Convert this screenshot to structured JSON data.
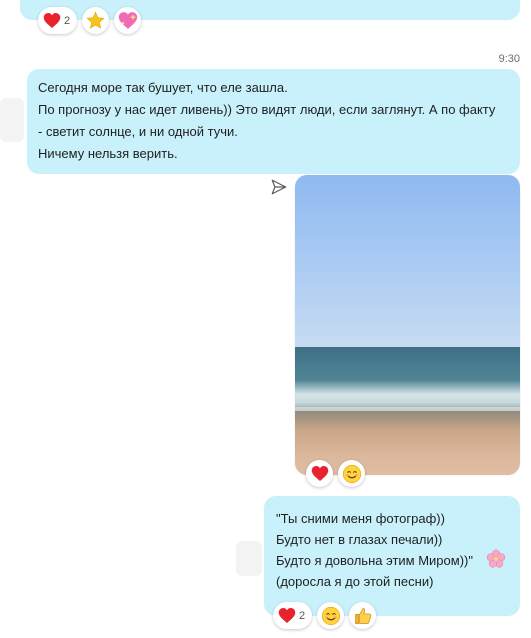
{
  "conversation": {
    "previous_message": {
      "reactions": [
        {
          "icon": "heart-icon",
          "count": "2"
        },
        {
          "icon": "star-icon",
          "count": ""
        },
        {
          "icon": "sparkling-heart-icon",
          "count": ""
        }
      ]
    },
    "text_message": {
      "time": "9:30",
      "lines": [
        "Сегодня море так бушует, что еле зашла.",
        "По прогнозу у нас идет ливень)) Это видят люди, если заглянут. А по факту",
        "- светит солнце, и ни одной тучи.",
        "Ничему нельзя верить."
      ]
    },
    "photo_message": {
      "image": "sea-beach-photo",
      "reactions": [
        {
          "icon": "heart-icon",
          "count": ""
        },
        {
          "icon": "smiling-face-icon",
          "count": ""
        }
      ]
    },
    "poem_message": {
      "lines": [
        "\"Ты сними меня фотограф))",
        "Будто нет в глазах печали))",
        "Будто я довольна этим Миром))\"",
        "(доросла я до этой песни)"
      ],
      "emoji": "cherry-blossom-icon",
      "reactions": [
        {
          "icon": "heart-icon",
          "count": "2"
        },
        {
          "icon": "smiling-face-icon",
          "count": ""
        },
        {
          "icon": "thumbs-up-icon",
          "count": ""
        }
      ]
    }
  },
  "colors": {
    "bubble": "#c9f1fb",
    "heart": "#e8232e",
    "star": "#f5c518"
  }
}
